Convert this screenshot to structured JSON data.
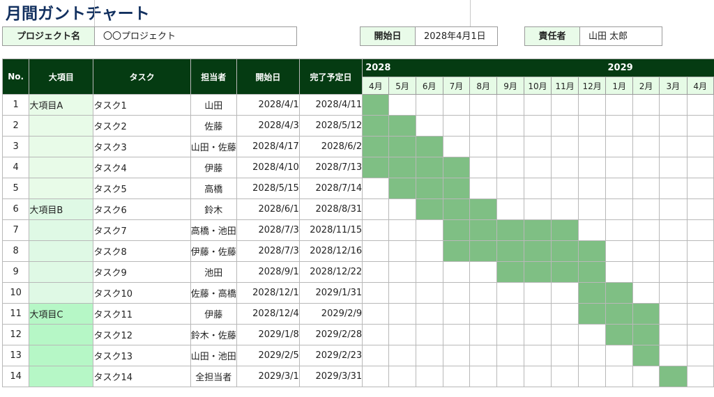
{
  "title": "月間ガントチャート",
  "project": {
    "label": "プロジェクト名",
    "value": "〇〇プロジェクト"
  },
  "start": {
    "label": "開始日",
    "value": "2028年4月1日"
  },
  "owner": {
    "label": "責任者",
    "value": "山田 太郎"
  },
  "headers": {
    "no": "No.",
    "category": "大項目",
    "task": "タスク",
    "assignee": "担当者",
    "start": "開始日",
    "end": "完了予定日"
  },
  "years": [
    "2028",
    "2029"
  ],
  "months": [
    "4月",
    "5月",
    "6月",
    "7月",
    "8月",
    "9月",
    "10月",
    "11月",
    "12月",
    "1月",
    "2月",
    "3月",
    "4月"
  ],
  "colors": {
    "header_bg": "#053b12",
    "bar": "#7fbf84",
    "title": "#12305f"
  },
  "rows": [
    {
      "no": "1",
      "category": "大項目A",
      "task": "タスク1",
      "assignee": "山田",
      "start": "2028/4/1",
      "end": "2028/4/11",
      "cat_group": "a",
      "span": [
        0,
        0
      ]
    },
    {
      "no": "2",
      "category": "",
      "task": "タスク2",
      "assignee": "佐藤",
      "start": "2028/4/3",
      "end": "2028/5/12",
      "cat_group": "a",
      "span": [
        0,
        1
      ]
    },
    {
      "no": "3",
      "category": "",
      "task": "タスク3",
      "assignee": "山田・佐藤",
      "start": "2028/4/17",
      "end": "2028/6/2",
      "cat_group": "a",
      "span": [
        0,
        2
      ]
    },
    {
      "no": "4",
      "category": "",
      "task": "タスク4",
      "assignee": "伊藤",
      "start": "2028/4/10",
      "end": "2028/7/13",
      "cat_group": "a",
      "span": [
        0,
        3
      ]
    },
    {
      "no": "5",
      "category": "",
      "task": "タスク5",
      "assignee": "高橋",
      "start": "2028/5/15",
      "end": "2028/7/14",
      "cat_group": "a",
      "span": [
        1,
        3
      ]
    },
    {
      "no": "6",
      "category": "大項目B",
      "task": "タスク6",
      "assignee": "鈴木",
      "start": "2028/6/1",
      "end": "2028/8/31",
      "cat_group": "b",
      "span": [
        2,
        4
      ]
    },
    {
      "no": "7",
      "category": "",
      "task": "タスク7",
      "assignee": "高橋・池田",
      "start": "2028/7/3",
      "end": "2028/11/15",
      "cat_group": "b",
      "span": [
        3,
        7
      ]
    },
    {
      "no": "8",
      "category": "",
      "task": "タスク8",
      "assignee": "伊藤・佐藤",
      "start": "2028/7/3",
      "end": "2028/12/16",
      "cat_group": "b",
      "span": [
        3,
        8
      ]
    },
    {
      "no": "9",
      "category": "",
      "task": "タスク9",
      "assignee": "池田",
      "start": "2028/9/1",
      "end": "2028/12/22",
      "cat_group": "b",
      "span": [
        5,
        8
      ]
    },
    {
      "no": "10",
      "category": "",
      "task": "タスク10",
      "assignee": "佐藤・高橋",
      "start": "2028/12/1",
      "end": "2029/1/31",
      "cat_group": "b",
      "span": [
        8,
        9
      ]
    },
    {
      "no": "11",
      "category": "大項目C",
      "task": "タスク11",
      "assignee": "伊藤",
      "start": "2028/12/4",
      "end": "2029/2/9",
      "cat_group": "c",
      "span": [
        8,
        10
      ]
    },
    {
      "no": "12",
      "category": "",
      "task": "タスク12",
      "assignee": "鈴木・佐藤",
      "start": "2029/1/8",
      "end": "2029/2/28",
      "cat_group": "c",
      "span": [
        9,
        10
      ]
    },
    {
      "no": "13",
      "category": "",
      "task": "タスク13",
      "assignee": "山田・池田",
      "start": "2029/2/5",
      "end": "2029/2/23",
      "cat_group": "c",
      "span": [
        10,
        10
      ]
    },
    {
      "no": "14",
      "category": "",
      "task": "タスク14",
      "assignee": "全担当者",
      "start": "2029/3/1",
      "end": "2029/3/31",
      "cat_group": "c",
      "span": [
        11,
        11
      ]
    }
  ]
}
